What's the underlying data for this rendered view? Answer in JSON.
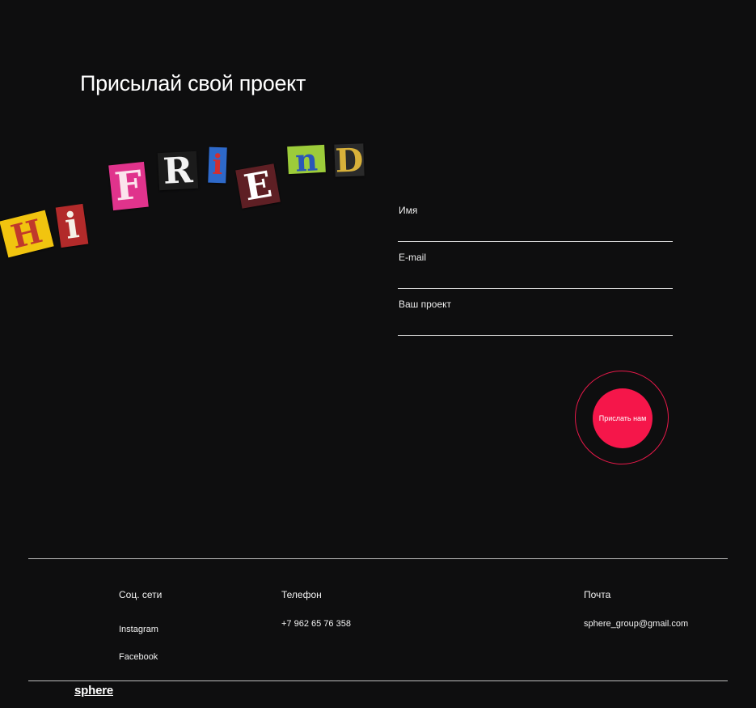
{
  "page": {
    "title": "Присылай свой проект"
  },
  "artwork": {
    "letters": [
      {
        "char": "H",
        "bg": "#f1c40f",
        "fg": "#c0392b"
      },
      {
        "char": "i",
        "bg": "#b22a2a",
        "fg": "#f5f0e6"
      },
      {
        "char": "F",
        "bg": "#e0338c",
        "fg": "#fbe3ec"
      },
      {
        "char": "R",
        "bg": "#1b1b1b",
        "fg": "#f2f2f2"
      },
      {
        "char": "i",
        "bg": "#2e69c9",
        "fg": "#d32f2f"
      },
      {
        "char": "E",
        "bg": "#5e1f24",
        "fg": "#ffffff"
      },
      {
        "char": "n",
        "bg": "#9ccc3a",
        "fg": "#2a56b8"
      },
      {
        "char": "D",
        "bg": "#2a2a2a",
        "fg": "#d8b13a"
      }
    ]
  },
  "form": {
    "name_label": "Имя",
    "email_label": "E-mail",
    "project_label": "Ваш проект",
    "name_value": "",
    "email_value": "",
    "project_value": "",
    "submit_label": "Прислать нам",
    "accent_color": "#f5164a"
  },
  "footer": {
    "social_heading": "Соц. сети",
    "social_links": [
      "Instagram",
      "Facebook"
    ],
    "phone_heading": "Телефон",
    "phone": "+7 962 65 76 358",
    "email_heading": "Почта",
    "email": "sphere_group@gmail.com",
    "logo": "sphere"
  }
}
